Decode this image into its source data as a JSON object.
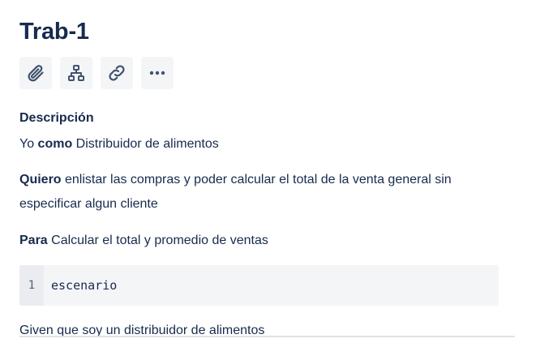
{
  "issue": {
    "title": "Trab-1"
  },
  "toolbar": {
    "buttons": [
      {
        "icon": "paperclip-icon"
      },
      {
        "icon": "hierarchy-icon"
      },
      {
        "icon": "link-icon"
      },
      {
        "icon": "more-icon"
      }
    ]
  },
  "description": {
    "label": "Descripción",
    "line1": {
      "pre": "Yo ",
      "bold": "como",
      "post": " Distribuidor de alimentos"
    },
    "line2": {
      "bold": "Quiero",
      "post": " enlistar las compras y poder calcular el total de la venta general sin especificar algun cliente"
    },
    "line3": {
      "bold": "Para",
      "post": " Calcular el total y promedio de ventas"
    },
    "code": {
      "line_number": "1",
      "text": "escenario"
    },
    "line4": "Given que soy un distribuidor de alimentos"
  },
  "colors": {
    "text": "#172b4d",
    "button_bg": "#f4f5f7",
    "icon": "#42526e",
    "code_bg": "#f4f5f7",
    "gutter_bg": "#ebecf0"
  }
}
